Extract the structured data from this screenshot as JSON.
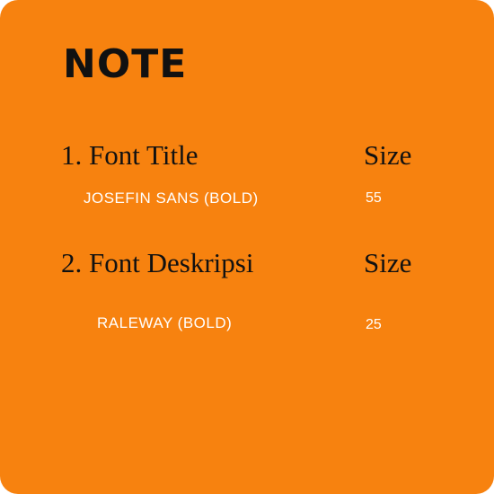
{
  "note": {
    "title": "NOTE",
    "rows": [
      {
        "heading": "1. Font Title",
        "size_label": "Size",
        "font": "JOSEFIN SANS (BOLD)",
        "size_value": "55"
      },
      {
        "heading": "2. Font Deskripsi",
        "size_label": "Size",
        "font": "RALEWAY (BOLD)",
        "size_value": "25"
      }
    ]
  },
  "colors": {
    "background": "#f7820f",
    "heading_text": "#111111",
    "detail_text": "#ffffff"
  }
}
